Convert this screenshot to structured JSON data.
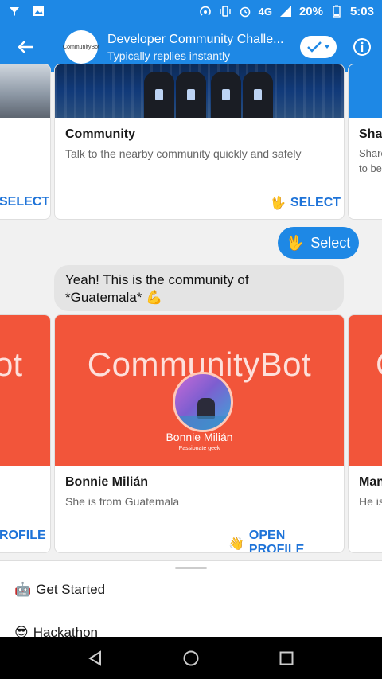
{
  "status_bar": {
    "network": "4G",
    "battery": "20%",
    "time": "5:03"
  },
  "header": {
    "avatar_text": "CommunityBot",
    "title": "Developer Community Challe...",
    "subtitle": "Typically replies instantly"
  },
  "carousel_top": {
    "left_partial_button": "SELECT",
    "card": {
      "title": "Community",
      "subtitle": "Talk to the nearby community quickly and safely",
      "button_label": "SELECT",
      "button_emoji": "🖖"
    },
    "right_partial": {
      "title": "Shar",
      "subtitle_line1": "Share",
      "subtitle_line2": "to be"
    }
  },
  "messages": {
    "outgoing": {
      "emoji": "🖖",
      "text": "Select"
    },
    "incoming": {
      "line1": "Yeah! This is the community of",
      "line2": "*Guatemala*",
      "emoji": "💪"
    }
  },
  "carousel_bottom": {
    "left_partial_text": "ot",
    "left_partial_button": "ROFILE",
    "card": {
      "banner_text": "CommunityBot",
      "banner_name": "Bonnie Milián",
      "banner_tagline": "Passionate geek",
      "title": "Bonnie Milián",
      "subtitle": "She is from Guatemala",
      "button_label": "OPEN PROFILE",
      "button_emoji": "👋"
    },
    "right_partial": {
      "banner_text": "C",
      "title": "Man",
      "subtitle": "He is"
    }
  },
  "quick_replies": [
    {
      "emoji": "🤖",
      "label": "Get Started"
    },
    {
      "emoji": "😎",
      "label": "Hackathon"
    }
  ],
  "colors": {
    "brand_blue": "#1e88e5",
    "link_blue": "#1e73d8",
    "banner_orange": "#f2553a"
  }
}
